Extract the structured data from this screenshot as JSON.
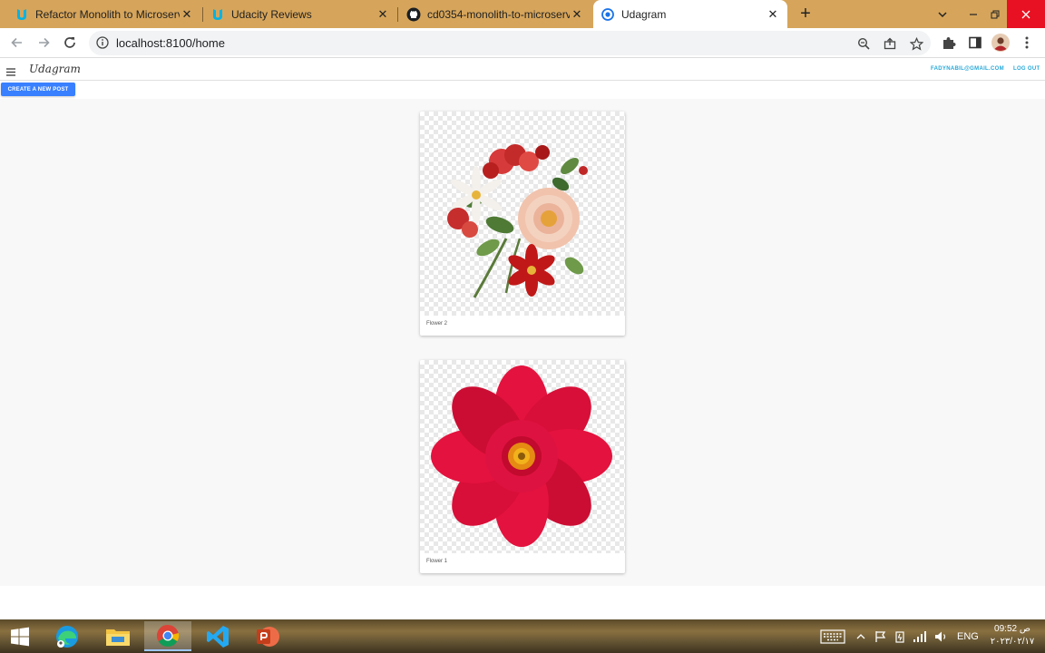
{
  "browser": {
    "tabs": [
      {
        "title": "Refactor Monolith to Microservic",
        "active": false,
        "icon": "udacity-icon"
      },
      {
        "title": "Udacity Reviews",
        "active": false,
        "icon": "udacity-icon"
      },
      {
        "title": "cd0354-monolith-to-microservic",
        "active": false,
        "icon": "github-icon"
      },
      {
        "title": "Udagram",
        "active": true,
        "icon": "chrome-loading-icon"
      }
    ],
    "url": "localhost:8100/home",
    "colors": {
      "tabstrip": "#d6a55b",
      "accent": "#3880ff"
    }
  },
  "app": {
    "brand": "Udagram",
    "user_email": "FADYNABIL@GMAIL.COM",
    "logout_label": "LOG OUT",
    "create_post_label": "CREATE A NEW POST",
    "posts": [
      {
        "caption": "Flower 2",
        "image": "bouquet-image"
      },
      {
        "caption": "Flower 1",
        "image": "red-flower-image"
      }
    ]
  },
  "taskbar": {
    "apps": [
      "windows-start-icon",
      "edge-icon",
      "file-explorer-icon",
      "chrome-icon",
      "vscode-icon",
      "powerpoint-icon"
    ],
    "language": "ENG",
    "time": "09:52",
    "ampm": "ص",
    "date": "٢٠٢٣/٠٢/١٧"
  }
}
